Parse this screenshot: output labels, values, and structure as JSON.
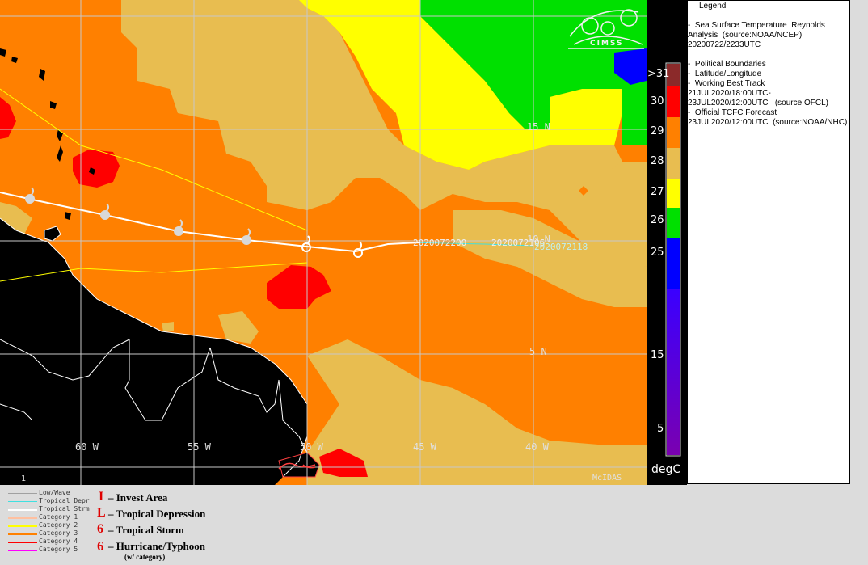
{
  "map": {
    "lon_labels": [
      "60 W",
      "55 W",
      "50 W",
      "45 W",
      "40 W"
    ],
    "lat_labels": [
      "15 N",
      "10 N",
      "5 N"
    ],
    "track_labels": [
      "2020072200",
      "2020072106",
      "2020072118"
    ],
    "corner_label": "1",
    "mcidas_label": "McIDAS",
    "logo_text": "CIMSS"
  },
  "colorbar": {
    "tick_labels": [
      ">31",
      "30",
      "29",
      "28",
      "27",
      "26",
      "25",
      "15",
      "5"
    ],
    "unit_label": "degC",
    "colors": {
      "gt31": "#8b2a2a",
      "c30": "#ff0000",
      "c29": "#ff8000",
      "c28": "#e8bd50",
      "c27": "#ffff00",
      "c26": "#00e000",
      "c25": "#0000ff",
      "c15": "#5a00c0"
    }
  },
  "legend": {
    "title": "Legend",
    "line1": "-  Sea Surface Temperature  Reynolds",
    "line2": "Analysis  (source:NOAA/NCEP)",
    "line3": "20200722/2233UTC",
    "line4": "-  Political Boundaries",
    "line5": "-  Latitude/Longitude",
    "line6": "-  Working Best Track",
    "line7": "21JUL2020/18:00UTC-",
    "line8": "23JUL2020/12:00UTC   (source:OFCL)",
    "line9": "-  Official TCFC Forecast",
    "line10": "23JUL2020/12:00UTC  (source:NOAA/NHC)"
  },
  "bottom_legend": {
    "track_types": [
      {
        "label": "Low/Wave",
        "color": "#a0a0a0"
      },
      {
        "label": "Tropical Depr",
        "color": "#40e0e0"
      },
      {
        "label": "Tropical Strm",
        "color": "#ffffff"
      },
      {
        "label": "Category 1",
        "color": "#ffc0a0"
      },
      {
        "label": "Category 2",
        "color": "#ffff00"
      },
      {
        "label": "Category 3",
        "color": "#ff8000"
      },
      {
        "label": "Category 4",
        "color": "#ff0000"
      },
      {
        "label": "Category 5",
        "color": "#ff00ff"
      }
    ],
    "symbols": [
      {
        "glyph": "I",
        "label": "– Invest Area"
      },
      {
        "glyph": "L",
        "label": "– Tropical Depression"
      },
      {
        "glyph": "6",
        "label": "– Tropical Storm"
      },
      {
        "glyph": "6",
        "label": "– Hurricane/Typhoon"
      }
    ],
    "category_note": "(w/ category)"
  }
}
